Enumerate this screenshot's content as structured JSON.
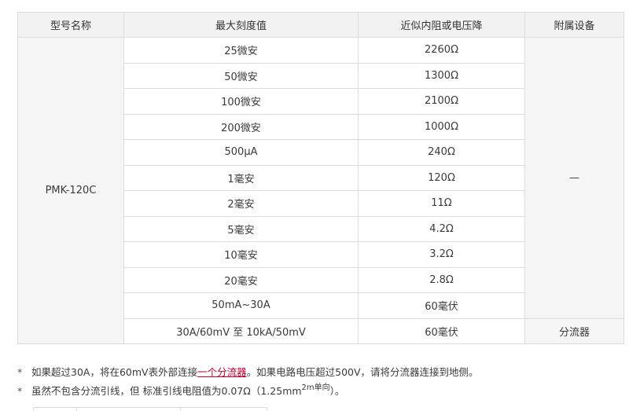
{
  "table": {
    "headers": [
      "型号名称",
      "最大刻度值",
      "近似内阻或电压降",
      "附属设备"
    ],
    "model": "PMK-120C",
    "accessory": "—",
    "rows": [
      {
        "range": "25微安",
        "value": "2260Ω"
      },
      {
        "range": "50微安",
        "value": "1300Ω"
      },
      {
        "range": "100微安",
        "value": "2100Ω"
      },
      {
        "range": "200微安",
        "value": "1000Ω"
      },
      {
        "range": "500μA",
        "value": "240Ω"
      },
      {
        "range": "1毫安",
        "value": "120Ω"
      },
      {
        "range": "2毫安",
        "value": "11Ω"
      },
      {
        "range": "5毫安",
        "value": "4.2Ω"
      },
      {
        "range": "10毫安",
        "value": "3.2Ω"
      },
      {
        "range": "20毫安",
        "value": "2.8Ω"
      },
      {
        "range": "50mA~30A",
        "value": "60毫伏"
      }
    ],
    "shunt_row": {
      "range": "30A/60mV 至 10kA/50mV",
      "value": "60毫伏",
      "accessory": "分流器"
    }
  },
  "notes": {
    "mark": "*",
    "note1_before": "如果超过30A，将在60mV表外部连接",
    "note1_link": "一个分流器",
    "note1_after": "。如果电路电压超过500V，请将分流器连接到地侧。",
    "note2_before": "虽然不包含分流引线，但  标准引线电阻值为0.07Ω（1.25mm",
    "note2_sup": "2m单向",
    "note2_after": "）。"
  }
}
